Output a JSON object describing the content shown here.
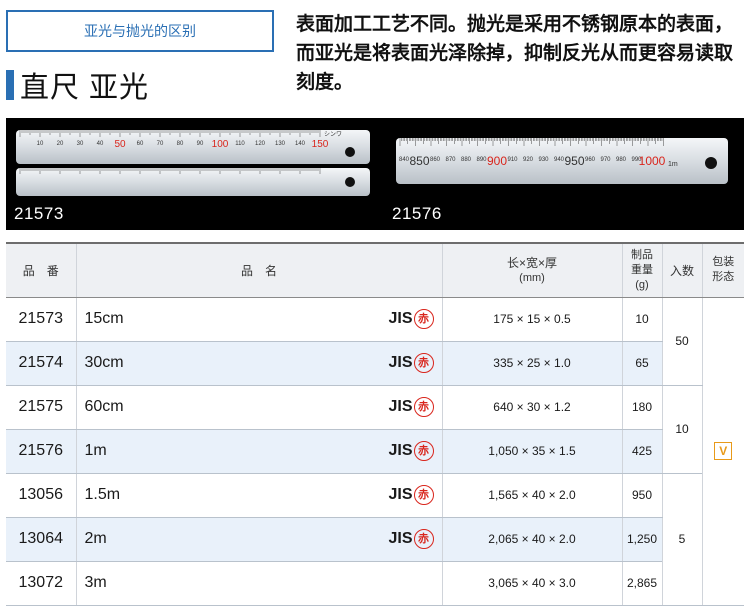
{
  "header": {
    "tag": "亚光与抛光的区别",
    "title": "直尺 亚光",
    "description": "表面加工工艺不同。抛光是采用不锈钢原本的表面，而亚光是将表面光泽除掉，抑制反光从而更容易读取刻度。"
  },
  "photo": {
    "label_left": "21573",
    "label_right": "21576",
    "ruler_top_numbers": [
      "10",
      "20",
      "30",
      "40",
      "50",
      "60",
      "70",
      "80",
      "90",
      "100",
      "110",
      "120",
      "130",
      "140",
      "150"
    ],
    "ruler_right_numbers": [
      "840",
      "850",
      "860",
      "870",
      "880",
      "890",
      "900",
      "910",
      "920",
      "930",
      "940",
      "950",
      "960",
      "970",
      "980",
      "990",
      "1000"
    ],
    "ruler_right_unit": "1m",
    "brand": "シンワ"
  },
  "table": {
    "headers": {
      "code": "品　番",
      "name": "品　名",
      "dims": "长×宽×厚",
      "dims_unit": "(mm)",
      "weight_l1": "制品",
      "weight_l2": "重量",
      "weight_l3": "(g)",
      "qty": "入数",
      "pack_l1": "包装",
      "pack_l2": "形态"
    },
    "jis_label": "JIS",
    "aka_label": "赤",
    "rows": [
      {
        "code": "21573",
        "size": "15cm",
        "dims": "175 × 15 × 0.5",
        "weight": "10"
      },
      {
        "code": "21574",
        "size": "30cm",
        "dims": "335 × 25 × 1.0",
        "weight": "65"
      },
      {
        "code": "21575",
        "size": "60cm",
        "dims": "640 × 30 × 1.2",
        "weight": "180"
      },
      {
        "code": "21576",
        "size": "1m",
        "dims": "1,050 × 35 × 1.5",
        "weight": "425"
      },
      {
        "code": "13056",
        "size": "1.5m",
        "dims": "1,565 × 40 × 2.0",
        "weight": "950"
      },
      {
        "code": "13064",
        "size": "2m",
        "dims": "2,065 × 40 × 2.0",
        "weight": "1,250"
      },
      {
        "code": "13072",
        "size": "3m",
        "dims": "3,065 × 40 × 3.0",
        "weight": "2,865"
      }
    ],
    "qty_groups": [
      "50",
      "10",
      "5"
    ],
    "pack_mark": "V"
  },
  "colors": {
    "accent_blue": "#2a6fb4",
    "red_number": "#d9251c",
    "row_alt": "#e9f1fa",
    "pack_mark": "#e89a1a"
  }
}
